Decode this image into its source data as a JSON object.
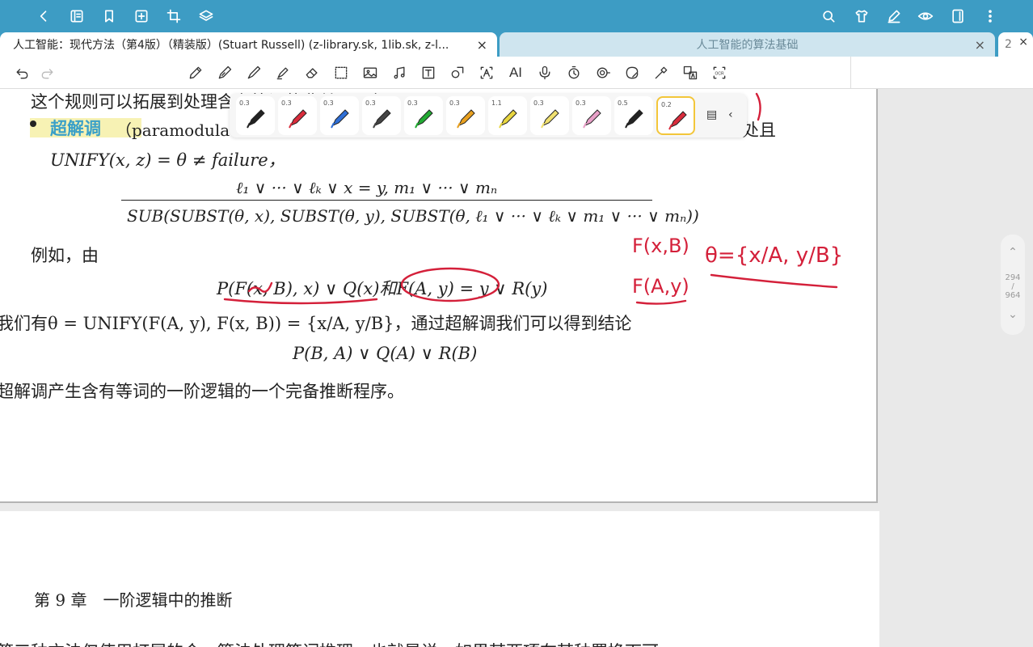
{
  "tabs": {
    "active_label": "人工智能：现代方法（第4版）（精装版）(Stuart Russell) (z-library.sk, 1lib.sk, z-l...",
    "inactive_label": "人工智能的算法基础",
    "count_label": "2",
    "close_glyph": "×"
  },
  "pen_widths": [
    "0.3",
    "0.3",
    "0.3",
    "0.3",
    "0.3",
    "0.3",
    "1.1",
    "0.3",
    "0.3",
    "0.5",
    "0.2"
  ],
  "pen_colors": [
    "#222222",
    "#d92c3c",
    "#2f6fd6",
    "#444444",
    "#22aa33",
    "#e8a020",
    "#e8d640",
    "#f0e070",
    "#e8a0c8",
    "#222222",
    "#d92c3c"
  ],
  "page": {
    "line1": "这个规则可以拓展到处理含有等词的非单元子句",
    "bullet_term": "超解调",
    "bullet_paren": "（paramodulati",
    "bullet_end": "处且",
    "unify_line": "UNIFY(x, z) = θ ≠ failure，",
    "rule_num": "ℓ₁ ∨ ··· ∨ ℓₖ ∨ x = y,            m₁ ∨ ··· ∨ mₙ",
    "rule_den": "SUB(SUBST(θ, x), SUBST(θ, y), SUBST(θ, ℓ₁ ∨ ··· ∨ ℓₖ ∨ m₁ ∨ ··· ∨ mₙ))",
    "example_intro": "例如，由",
    "example_formula": "P(F(x, B), x) ∨ Q(x)和F(A, y) = y ∨ R(y)",
    "unify_result": "我们有θ = UNIFY(F(A, y), F(x, B)) = {x/A, y/B}，通过超解调我们可以得到结论",
    "conclusion": "P(B, A) ∨ Q(A) ∨ R(B)",
    "summary": "超解调产生含有等词的一阶逻辑的一个完备推断程序。",
    "chapter": "第 9 章　一阶逻辑中的推断",
    "next_line": "第三种方法仅使用打展的合一算法处理等词推理，也就是说，如果某两项在某种置换下可"
  },
  "notes": {
    "fxb": "F(x,B)",
    "fay": "F(A,y)",
    "theta": "θ={x/A, y/B}"
  },
  "sidebar": {
    "current": "294",
    "sep": "/",
    "total": "964"
  }
}
